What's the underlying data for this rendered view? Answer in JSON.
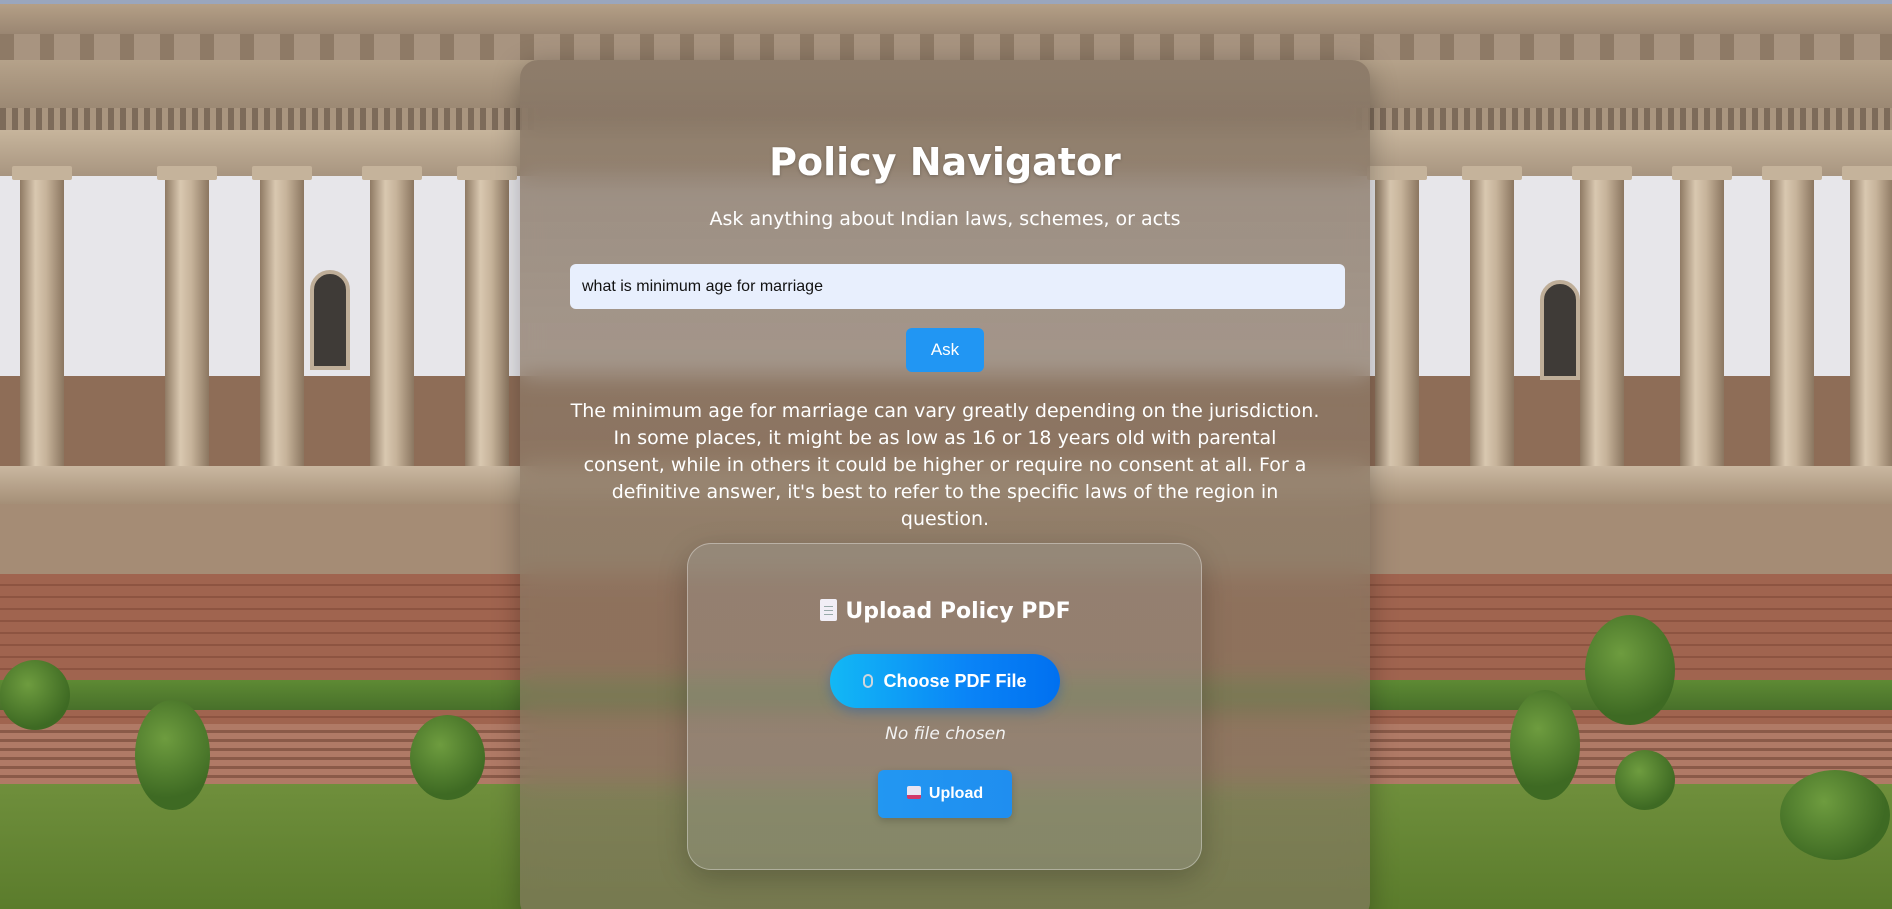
{
  "app": {
    "title": "Policy Navigator",
    "subtitle": "Ask anything about Indian laws, schemes, or acts"
  },
  "question": {
    "value": "what is minimum age for marriage",
    "ask_label": "Ask"
  },
  "answer": {
    "text": "The minimum age for marriage can vary greatly depending on the jurisdiction. In some places, it might be as low as 16 or 18 years old with parental consent, while in others it could be higher or require no consent at all. For a definitive answer, it's best to refer to the specific laws of the region in question."
  },
  "upload": {
    "title": "Upload Policy PDF",
    "title_icon": "document-icon",
    "choose_label": "Choose PDF File",
    "choose_icon": "paperclip-icon",
    "file_status": "No file chosen",
    "upload_label": "Upload",
    "upload_icon": "inbox-tray-icon"
  },
  "colors": {
    "accent_blue": "#2196f3",
    "gradient_start": "#12b8f5",
    "gradient_end": "#0070f0",
    "input_background": "#e8effd"
  }
}
